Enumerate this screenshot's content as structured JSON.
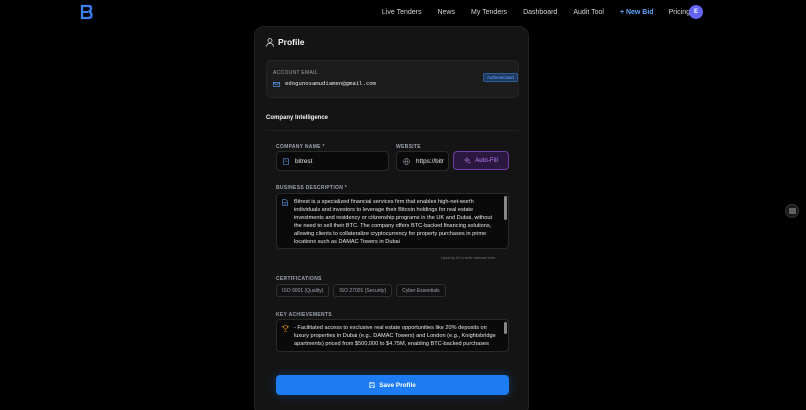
{
  "nav": {
    "links": [
      "Live Tenders",
      "News",
      "My Tenders",
      "Dashboard",
      "Audit Tool"
    ],
    "new_bid": "+ New Bid",
    "pricing": "Pricing",
    "avatar_initial": "E"
  },
  "profile": {
    "title": "Profile",
    "account_email_label": "ACCOUNT EMAIL",
    "email": "edogunosamudiamen@gmail.com",
    "badge": "Authenticated"
  },
  "company": {
    "section_title": "Company Intelligence",
    "name_label": "COMPANY NAME *",
    "name_value": "bitrest",
    "website_label": "WEBSITE",
    "website_value": "https://bitr",
    "autofill_label": "Auto-Fill",
    "description_label": "BUSINESS DESCRIPTION *",
    "description_value": "Bitrest is a specialized financial services firm that enables high-net-worth individuals and investors to leverage their Bitcoin holdings for real estate investments and residency or citizenship programs in the UK and Dubai, without the need to sell their BTC. The company offers BTC-backed financing solutions, allowing clients to collateralize cryptocurrency for property purchases in prime locations such as DAMAC Towers in Dubai",
    "description_hint": "Used by AI to write relevant bids",
    "certifications_label": "CERTIFICATIONS",
    "certifications": [
      "ISO 9001 (Quality)",
      "ISO 27001 (Security)",
      "Cyber Essentials"
    ],
    "achievements_label": "KEY ACHIEVEMENTS",
    "achievements_value": "- Facilitated access to exclusive real estate opportunities like 20% deposits on luxury properties in Dubai (e.g., DAMAC Towers) and London (e.g., Knightsbridge apartments) priced from $500,000 to $4.75M, enabling BTC-backed purchases",
    "save_label": "Save Profile"
  },
  "colors": {
    "accent": "#1d7cf2",
    "link_accent": "#60a5fa",
    "purple": "#c084fc"
  }
}
